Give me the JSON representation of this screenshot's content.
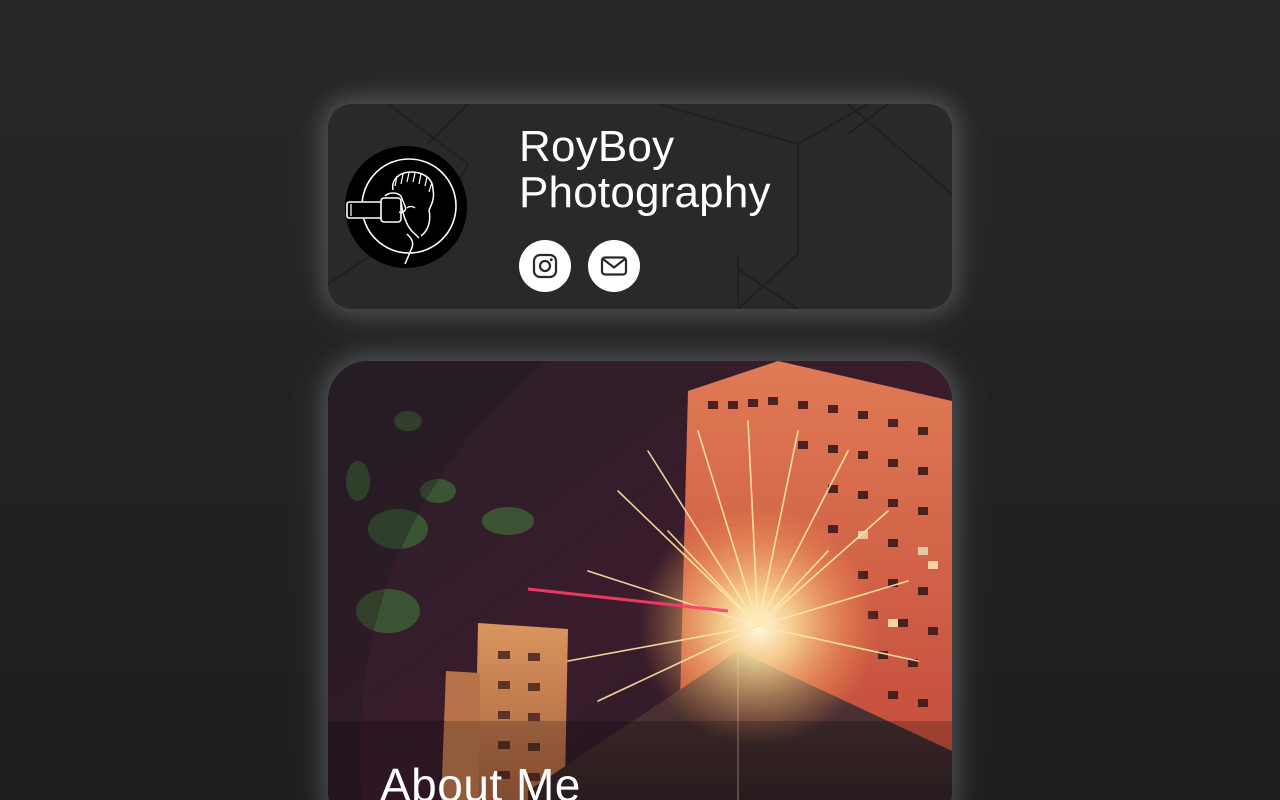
{
  "profile": {
    "name_line1": "RoyBoy",
    "name_line2": "Photography",
    "avatar": "photographer-logo",
    "social": [
      {
        "icon": "instagram-icon",
        "label": "Instagram"
      },
      {
        "icon": "mail-icon",
        "label": "Email"
      }
    ]
  },
  "about": {
    "title": "About Me",
    "image": "fireworks-over-buildings-photo"
  },
  "colors": {
    "background": "#232425",
    "card": "#292929",
    "glow": "#ffffff",
    "icon_bg": "#ffffff",
    "icon_fg": "#292929"
  }
}
